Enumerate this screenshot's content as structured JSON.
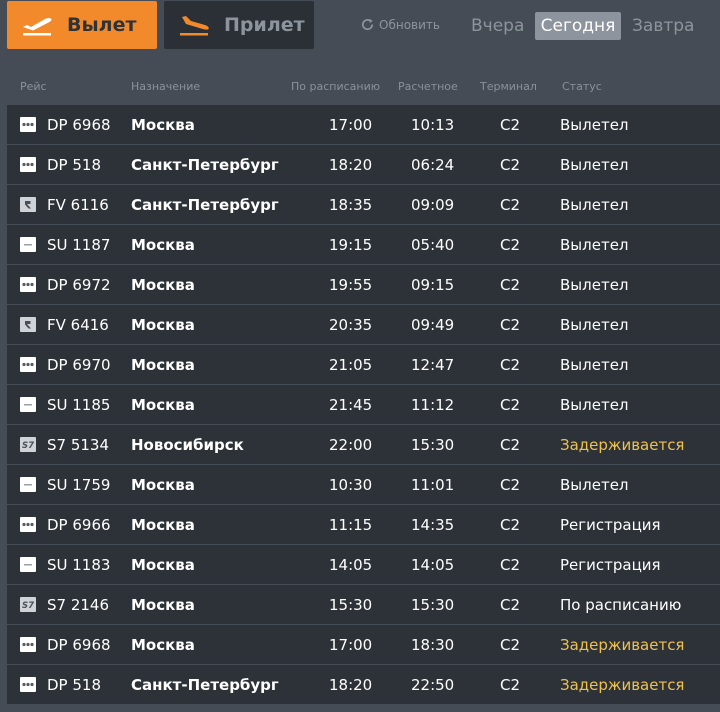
{
  "tabs": {
    "departure_label": "Вылет",
    "arrival_label": "Прилет"
  },
  "refresh_label": "Обновить",
  "days": {
    "yesterday": "Вчера",
    "today": "Сегодня",
    "tomorrow": "Завтра",
    "selected": "today"
  },
  "columns": {
    "flight": "Рейс",
    "destination": "Назначение",
    "scheduled": "По расписанию",
    "estimated": "Расчетное",
    "terminal": "Терминал",
    "status": "Статус"
  },
  "colors": {
    "accent": "#f28a2c",
    "delayed": "#f1c14f",
    "row_bg": "#2d3238",
    "page_bg": "#454c56"
  },
  "flights": [
    {
      "logo": "dots-logo-icon",
      "flight": "DP 6968",
      "destination": "Москва",
      "scheduled": "17:00",
      "estimated": "10:13",
      "terminal": "C2",
      "status": "Вылетел",
      "delayed": false
    },
    {
      "logo": "dots-logo-icon",
      "flight": "DP 518",
      "destination": "Санкт-Петербург",
      "scheduled": "18:20",
      "estimated": "06:24",
      "terminal": "C2",
      "status": "Вылетел",
      "delayed": false
    },
    {
      "logo": "r-logo-icon",
      "flight": "FV 6116",
      "destination": "Санкт-Петербург",
      "scheduled": "18:35",
      "estimated": "09:09",
      "terminal": "C2",
      "status": "Вылетел",
      "delayed": false
    },
    {
      "logo": "dash-logo-icon",
      "flight": "SU 1187",
      "destination": "Москва",
      "scheduled": "19:15",
      "estimated": "05:40",
      "terminal": "C2",
      "status": "Вылетел",
      "delayed": false
    },
    {
      "logo": "dots-logo-icon",
      "flight": "DP 6972",
      "destination": "Москва",
      "scheduled": "19:55",
      "estimated": "09:15",
      "terminal": "C2",
      "status": "Вылетел",
      "delayed": false
    },
    {
      "logo": "r-logo-icon",
      "flight": "FV 6416",
      "destination": "Москва",
      "scheduled": "20:35",
      "estimated": "09:49",
      "terminal": "C2",
      "status": "Вылетел",
      "delayed": false
    },
    {
      "logo": "dots-logo-icon",
      "flight": "DP 6970",
      "destination": "Москва",
      "scheduled": "21:05",
      "estimated": "12:47",
      "terminal": "C2",
      "status": "Вылетел",
      "delayed": false
    },
    {
      "logo": "dash-logo-icon",
      "flight": "SU 1185",
      "destination": "Москва",
      "scheduled": "21:45",
      "estimated": "11:12",
      "terminal": "C2",
      "status": "Вылетел",
      "delayed": false
    },
    {
      "logo": "s7-logo-icon",
      "flight": "S7 5134",
      "destination": "Новосибирск",
      "scheduled": "22:00",
      "estimated": "15:30",
      "terminal": "C2",
      "status": "Задерживается",
      "delayed": true
    },
    {
      "logo": "dash-logo-icon",
      "flight": "SU 1759",
      "destination": "Москва",
      "scheduled": "10:30",
      "estimated": "11:01",
      "terminal": "C2",
      "status": "Вылетел",
      "delayed": false
    },
    {
      "logo": "dots-logo-icon",
      "flight": "DP 6966",
      "destination": "Москва",
      "scheduled": "11:15",
      "estimated": "14:35",
      "terminal": "C2",
      "status": "Регистрация",
      "delayed": false
    },
    {
      "logo": "dash-logo-icon",
      "flight": "SU 1183",
      "destination": "Москва",
      "scheduled": "14:05",
      "estimated": "14:05",
      "terminal": "C2",
      "status": "Регистрация",
      "delayed": false
    },
    {
      "logo": "s7-logo-icon",
      "flight": "S7 2146",
      "destination": "Москва",
      "scheduled": "15:30",
      "estimated": "15:30",
      "terminal": "C2",
      "status": "По расписанию",
      "delayed": false
    },
    {
      "logo": "dots-logo-icon",
      "flight": "DP 6968",
      "destination": "Москва",
      "scheduled": "17:00",
      "estimated": "18:30",
      "terminal": "C2",
      "status": "Задерживается",
      "delayed": true
    },
    {
      "logo": "dots-logo-icon",
      "flight": "DP 518",
      "destination": "Санкт-Петербург",
      "scheduled": "18:20",
      "estimated": "22:50",
      "terminal": "C2",
      "status": "Задерживается",
      "delayed": true
    }
  ]
}
